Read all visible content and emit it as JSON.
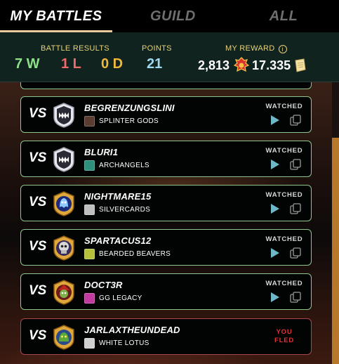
{
  "tabs": [
    {
      "label": "MY BATTLES",
      "active": true
    },
    {
      "label": "GUILD",
      "active": false
    },
    {
      "label": "ALL",
      "active": false
    }
  ],
  "stats": {
    "battle_results_label": "BATTLE RESULTS",
    "wins": "7 W",
    "losses": "1 L",
    "draws": "0 D",
    "points_label": "POINTS",
    "points": "21",
    "reward_label": "MY REWARD",
    "reward_sps": "2,813",
    "reward_dec": "17.335"
  },
  "colors": {
    "win": "#8fe08a",
    "loss": "#ef6a6a",
    "draw": "#f0b83a",
    "points": "#9fd9f0",
    "label_gold": "#e8d27a",
    "card_border": "#8fc68c",
    "fled_border": "#a8484e",
    "fled_text": "#e0333a",
    "accent": "#e8c89c"
  },
  "battles": [
    {
      "vs": "VS",
      "player": "BEGRENZUNGSLINI",
      "guild": "SPLINTER GODS",
      "status": "WATCHED",
      "avatar": "monster-mouth-icon",
      "guild_color": "#5a3d30"
    },
    {
      "vs": "VS",
      "player": "BLURI1",
      "guild": "ARCHANGELS",
      "status": "WATCHED",
      "avatar": "monster-mouth-icon",
      "guild_color": "#2f8f7f"
    },
    {
      "vs": "VS",
      "player": "NIGHTMARE15",
      "guild": "SILVERCARDS",
      "status": "WATCHED",
      "avatar": "blue-spirit-icon",
      "guild_color": "#bfbfbf"
    },
    {
      "vs": "VS",
      "player": "SPARTACUS12",
      "guild": "BEARDED BEAVERS",
      "status": "WATCHED",
      "avatar": "skull-warrior-icon",
      "guild_color": "#b7c03a"
    },
    {
      "vs": "VS",
      "player": "DOCT3R",
      "guild": "GG LEGACY",
      "status": "WATCHED",
      "avatar": "red-hat-goblin-icon",
      "guild_color": "#c03aa0"
    },
    {
      "vs": "VS",
      "player": "JARLAXTHEUNDEAD",
      "guild": "WHITE LOTUS",
      "status": "YOU FLED",
      "status_line1": "YOU",
      "status_line2": "FLED",
      "avatar": "green-creature-icon",
      "guild_color": "#d0d0d0"
    }
  ],
  "icons": {
    "info": "info-icon",
    "sps_token": "red-sps-token-icon",
    "dec_token": "dec-scroll-icon",
    "play": "play-icon",
    "copy": "copy-icon"
  }
}
